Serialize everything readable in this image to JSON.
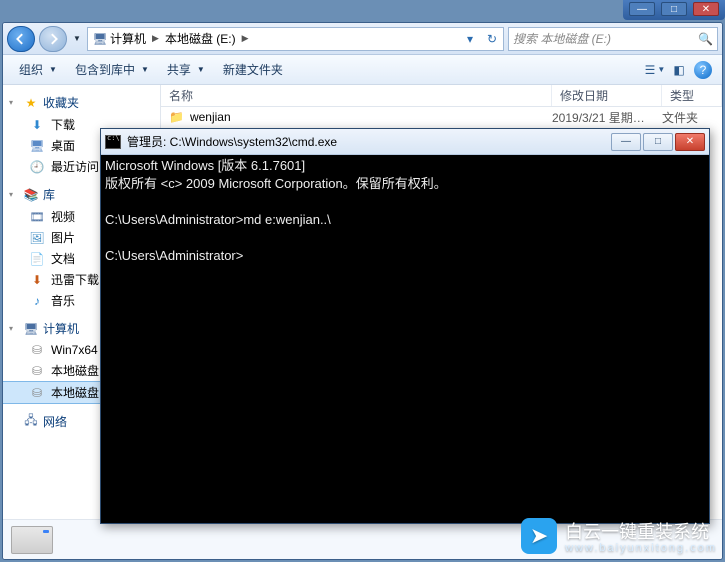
{
  "outer_chrome": {
    "min": "—",
    "max": "□",
    "close": "✕"
  },
  "nav": {
    "path_segments": [
      {
        "icon": "computer",
        "label": "计算机"
      },
      {
        "icon": "",
        "label": "本地磁盘 (E:)"
      }
    ],
    "search_placeholder": "搜索 本地磁盘 (E:)"
  },
  "toolbar": {
    "organize": "组织",
    "include": "包含到库中",
    "share": "共享",
    "newfolder": "新建文件夹"
  },
  "sidebar": {
    "favorites": {
      "label": "收藏夹",
      "items": [
        {
          "key": "downloads",
          "label": "下载"
        },
        {
          "key": "desktop",
          "label": "桌面"
        },
        {
          "key": "recent",
          "label": "最近访问"
        }
      ]
    },
    "libraries": {
      "label": "库",
      "items": [
        {
          "key": "video",
          "label": "视频"
        },
        {
          "key": "pictures",
          "label": "图片"
        },
        {
          "key": "documents",
          "label": "文档"
        },
        {
          "key": "xunlei",
          "label": "迅雷下载"
        },
        {
          "key": "music",
          "label": "音乐"
        }
      ]
    },
    "computer": {
      "label": "计算机",
      "items": [
        {
          "key": "win7",
          "label": "Win7x64"
        },
        {
          "key": "local-d",
          "label": "本地磁盘"
        },
        {
          "key": "local-e",
          "label": "本地磁盘"
        }
      ]
    },
    "network": {
      "label": "网络"
    }
  },
  "columns": {
    "name": "名称",
    "modified": "修改日期",
    "type": "类型"
  },
  "files": [
    {
      "name": "wenjian",
      "modified": "2019/3/21 星期…",
      "type": "文件夹"
    }
  ],
  "cmd": {
    "title": "管理员: C:\\Windows\\system32\\cmd.exe",
    "lines": [
      "Microsoft Windows [版本 6.1.7601]",
      "版权所有 <c> 2009 Microsoft Corporation。保留所有权利。",
      "",
      "C:\\Users\\Administrator>md e:wenjian..\\",
      "",
      "C:\\Users\\Administrator>"
    ]
  },
  "watermark": {
    "text": "白云一键重装系统",
    "sub": "www.baiyunxitong.com"
  }
}
